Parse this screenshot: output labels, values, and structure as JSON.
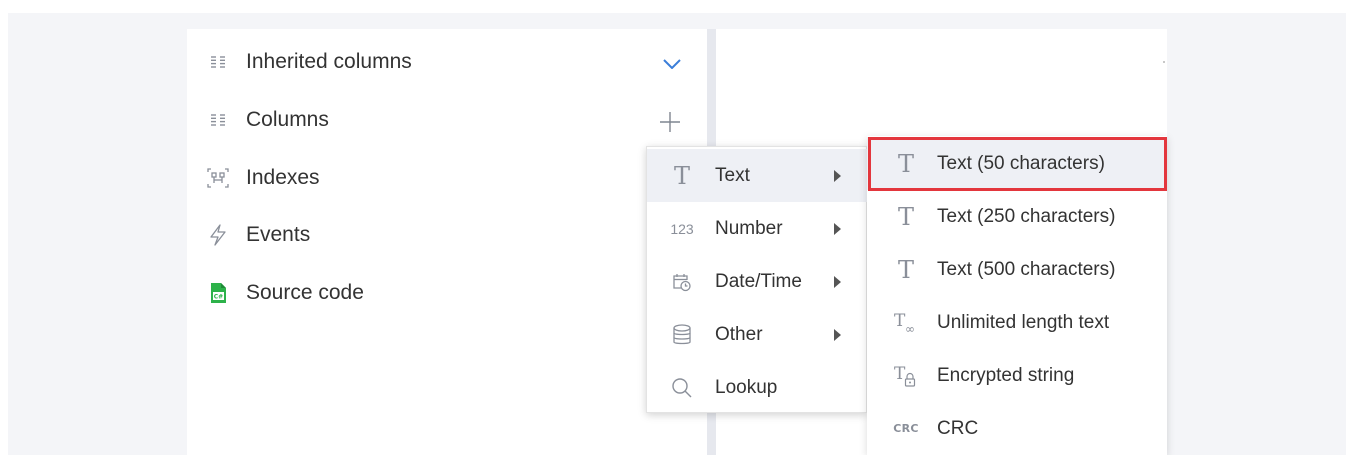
{
  "sidebar": {
    "items": [
      {
        "label": "Inherited columns",
        "icon": "columns-icon"
      },
      {
        "label": "Columns",
        "icon": "columns-icon"
      },
      {
        "label": "Indexes",
        "icon": "indexes-icon"
      },
      {
        "label": "Events",
        "icon": "lightning-icon"
      },
      {
        "label": "Source code",
        "icon": "source-code-icon"
      }
    ]
  },
  "column_types_menu": {
    "items": [
      {
        "label": "Text",
        "icon": "text-type-icon"
      },
      {
        "label": "Number",
        "icon": "number-type-icon",
        "glyph": "123"
      },
      {
        "label": "Date/Time",
        "icon": "calendar-clock-icon"
      },
      {
        "label": "Other",
        "icon": "database-icon"
      },
      {
        "label": "Lookup",
        "icon": "search-icon"
      }
    ]
  },
  "text_submenu": {
    "items": [
      {
        "label": "Text (50 characters)",
        "icon": "text-type-icon"
      },
      {
        "label": "Text (250 characters)",
        "icon": "text-type-icon"
      },
      {
        "label": "Text (500 characters)",
        "icon": "text-type-icon"
      },
      {
        "label": "Unlimited length text",
        "icon": "unlimited-text-icon"
      },
      {
        "label": "Encrypted string",
        "icon": "encrypted-text-icon"
      },
      {
        "label": "CRC",
        "icon": "crc-icon",
        "glyph": "CRC"
      }
    ]
  },
  "colors": {
    "accent": "#3b7ed9",
    "highlight_border": "#e3363d",
    "source_code_icon": "#2db24a"
  }
}
